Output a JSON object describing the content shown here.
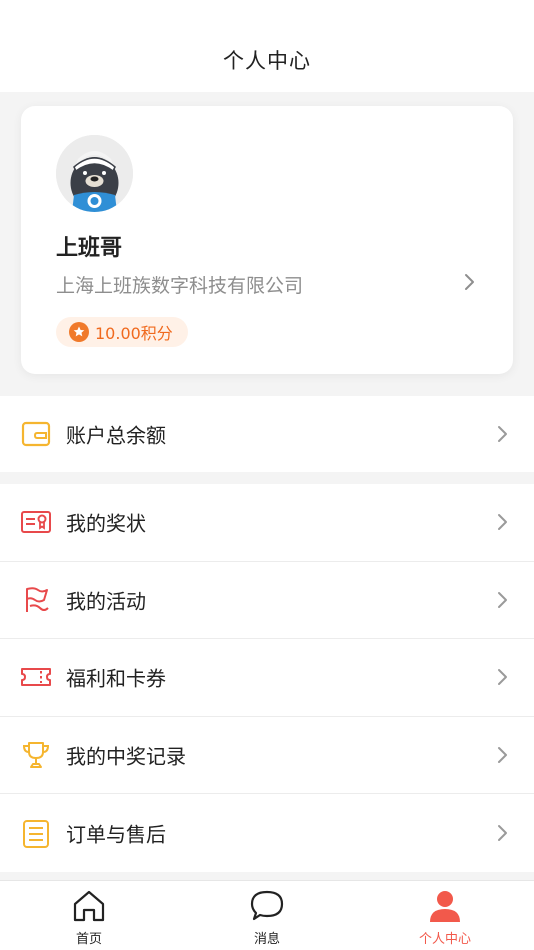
{
  "header": {
    "title": "个人中心"
  },
  "profile": {
    "name": "上班哥",
    "company": "上海上班族数字科技有限公司",
    "points": "10.00积分"
  },
  "balance": {
    "label": "账户总余额"
  },
  "menu": [
    {
      "label": "我的奖状",
      "icon": "certificate-icon"
    },
    {
      "label": "我的活动",
      "icon": "flag-icon"
    },
    {
      "label": "福利和卡券",
      "icon": "coupon-icon"
    },
    {
      "label": "我的中奖记录",
      "icon": "trophy-icon"
    },
    {
      "label": "订单与售后",
      "icon": "order-icon"
    }
  ],
  "tabbar": {
    "tabs": [
      {
        "label": "首页",
        "icon": "home-icon"
      },
      {
        "label": "消息",
        "icon": "message-icon"
      },
      {
        "label": "个人中心",
        "icon": "user-icon",
        "active": true
      }
    ]
  },
  "colors": {
    "accent": "#f2594b",
    "points": "#f06a1e",
    "wallet": "#f5b52f",
    "menu_red": "#e8494b"
  }
}
